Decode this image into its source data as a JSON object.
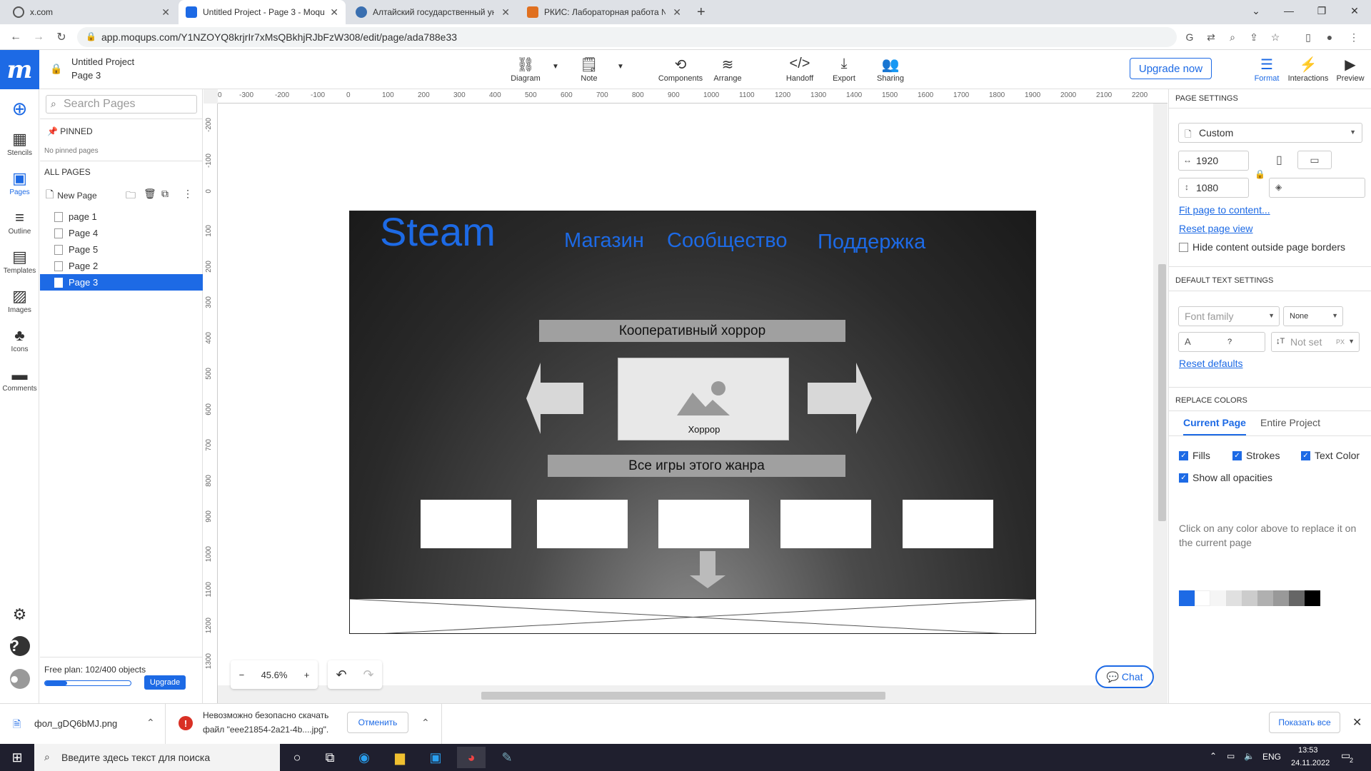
{
  "browser": {
    "tabs": [
      {
        "label": "x.com",
        "icon_color": "#555"
      },
      {
        "label": "Untitled Project - Page 3 - Moqups",
        "icon_color": "#1d6ae5"
      },
      {
        "label": "Алтайский государственный ун",
        "icon_color": "#3a6fb0"
      },
      {
        "label": "РКИС: Лабораторная работа №",
        "icon_color": "#e07020"
      }
    ],
    "url": "app.moqups.com/Y1NZOYQ8krjrIr7xMsQBkhjRJbFzW308/edit/page/ada788e33"
  },
  "header": {
    "project_title": "Untitled Project",
    "page_title": "Page 3",
    "tools": [
      {
        "label": "Diagram",
        "icon": "diagram-icon"
      },
      {
        "label": "Note",
        "icon": "note-icon"
      },
      {
        "label": "Components",
        "icon": "components-icon"
      },
      {
        "label": "Arrange",
        "icon": "arrange-icon"
      },
      {
        "label": "Handoff",
        "icon": "code-icon"
      },
      {
        "label": "Export",
        "icon": "export-icon"
      },
      {
        "label": "Sharing",
        "icon": "sharing-icon"
      }
    ],
    "upgrade_label": "Upgrade now",
    "right_tools": [
      {
        "label": "Format",
        "icon": "format-icon"
      },
      {
        "label": "Interactions",
        "icon": "bolt-icon"
      },
      {
        "label": "Preview",
        "icon": "play-icon"
      }
    ]
  },
  "rail": {
    "items": [
      {
        "label": "",
        "icon": "add-icon"
      },
      {
        "label": "Stencils",
        "icon": "stencils-icon"
      },
      {
        "label": "Pages",
        "icon": "pages-icon"
      },
      {
        "label": "Outline",
        "icon": "outline-icon"
      },
      {
        "label": "Templates",
        "icon": "templates-icon"
      },
      {
        "label": "Images",
        "icon": "images-icon"
      },
      {
        "label": "Icons",
        "icon": "club-icon"
      },
      {
        "label": "Comments",
        "icon": "comments-icon"
      }
    ]
  },
  "pages_panel": {
    "search_placeholder": "Search Pages",
    "pinned_label": "PINNED",
    "no_pinned": "No pinned pages",
    "all_pages_label": "ALL PAGES",
    "new_page_label": "New Page",
    "pages": [
      "page 1",
      "Page 4",
      "Page 5",
      "Page 2",
      "Page 3"
    ],
    "selected_page": "Page 3",
    "plan_text": "Free plan: 102/400 objects",
    "plan_used": 102,
    "plan_total": 400,
    "upgrade_label": "Upgrade"
  },
  "rulers": {
    "h": [
      "0",
      "-300",
      "-200",
      "-100",
      "0",
      "100",
      "200",
      "300",
      "400",
      "500",
      "600",
      "700",
      "800",
      "900",
      "1000",
      "1100",
      "1200",
      "1300",
      "1400",
      "1500",
      "1600",
      "1700",
      "1800",
      "1900",
      "2000",
      "2100",
      "2200"
    ],
    "v": [
      "-200",
      "-100",
      "0",
      "100",
      "200",
      "300",
      "400",
      "500",
      "600",
      "700",
      "800",
      "900",
      "1000",
      "1100",
      "1200",
      "1300"
    ]
  },
  "design": {
    "logo": "Steam",
    "nav": [
      "Магазин",
      "Сообщество",
      "Поддержка"
    ],
    "genre_title": "Кооперативный хоррор",
    "hero_caption": "Хоррор",
    "all_games": "Все игры этого жанра"
  },
  "canvas": {
    "zoom": "45.6%",
    "chat_label": "Chat"
  },
  "right_panel": {
    "page_settings": "PAGE SETTINGS",
    "preset": "Custom",
    "width": "1920",
    "height": "1080",
    "fit_link": "Fit page to content...",
    "reset_view": "Reset page view",
    "hide_outside": "Hide content outside page borders",
    "default_text": "DEFAULT TEXT SETTINGS",
    "font_family_placeholder": "Font family",
    "font_style": "None",
    "font_size_placeholder": "?",
    "line_height_placeholder": "Not set",
    "line_height_unit": "PX",
    "reset_defaults": "Reset defaults",
    "replace_colors": "REPLACE COLORS",
    "tab_current": "Current Page",
    "tab_entire": "Entire Project",
    "cb_fills": "Fills",
    "cb_strokes": "Strokes",
    "cb_text": "Text Color",
    "cb_opacities": "Show all opacities",
    "swatches": [
      "#1d6ae5",
      "#ffffff",
      "#f5f5f5",
      "#e0e0e0",
      "#cccccc",
      "#b0b0b0",
      "#999999",
      "#666666",
      "#000000"
    ],
    "swatch_hint": "Click on any color above to replace it on the current page"
  },
  "downloads": {
    "file1": "фол_gDQ6bMJ.png",
    "warn_line1": "Невозможно безопасно скачать",
    "warn_line2": "файл \"eee21854-2a21-4b....jpg\".",
    "cancel_label": "Отменить",
    "show_all": "Показать все"
  },
  "taskbar": {
    "search_placeholder": "Введите здесь текст для поиска",
    "lang": "ENG",
    "time": "13:53",
    "date": "24.11.2022",
    "notif_count": "2"
  }
}
